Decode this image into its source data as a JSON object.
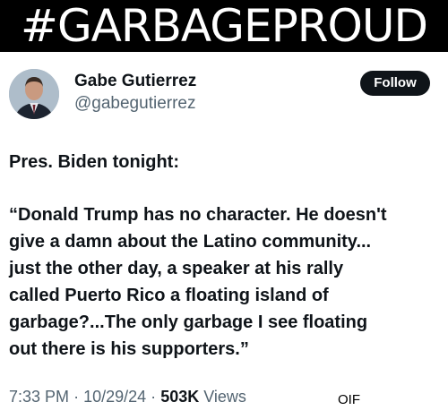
{
  "banner": {
    "text": "#GARBAGEPROUD"
  },
  "author": {
    "name": "Gabe Gutierrez",
    "handle": "@gabegutierrez"
  },
  "follow_button": {
    "label": "Follow"
  },
  "post": {
    "intro": "Pres. Biden tonight:",
    "quote_lines": [
      "“Donald Trump has no character. He doesn't",
      "give a damn about the Latino community...",
      "just the other day, a speaker at his rally",
      "called Puerto Rico a floating island of",
      "garbage?...The only garbage I see floating",
      "out there is his supporters.”"
    ]
  },
  "meta": {
    "time": "7:33 PM",
    "separator": "·",
    "date": "10/29/24",
    "views_count": "503K",
    "views_label": "Views"
  },
  "watermark": {
    "text": "OIF"
  }
}
